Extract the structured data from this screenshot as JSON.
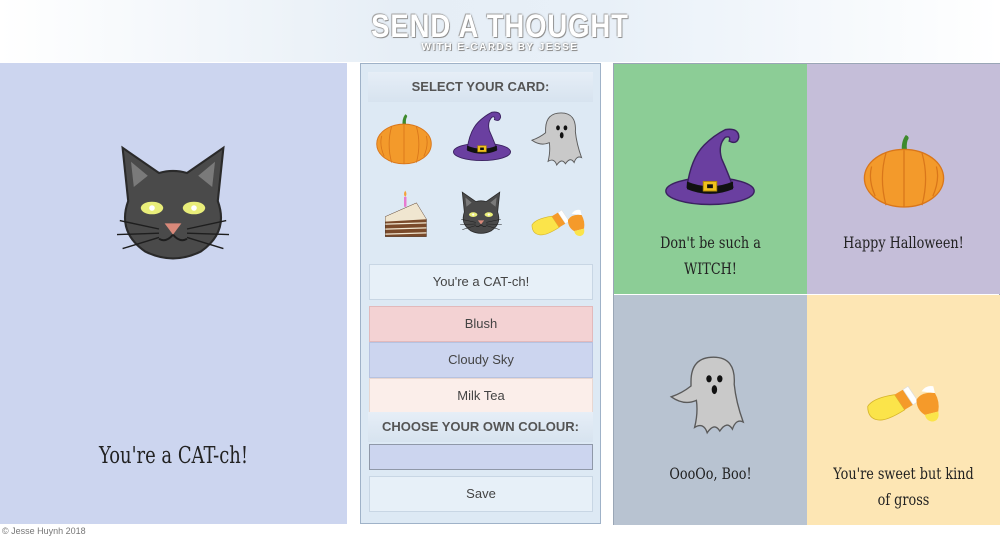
{
  "header": {
    "title": "SEND A THOUGHT",
    "subtitle": "WITH E-CARDS BY JESSE"
  },
  "preview": {
    "icon": "cat-icon",
    "message": "You're a CAT-ch!",
    "background": "#ccd5ef"
  },
  "controls": {
    "select_title": "SELECT YOUR CARD:",
    "icons": [
      "pumpkin-icon",
      "witch-hat-icon",
      "ghost-icon",
      "cake-icon",
      "cat-icon",
      "candy-corn-icon"
    ],
    "message_value": "You're a CAT-ch!",
    "colour_options": [
      {
        "label": "Blush",
        "color": "#f3d2d3"
      },
      {
        "label": "Cloudy Sky",
        "color": "#ccd5ef"
      },
      {
        "label": "Milk Tea",
        "color": "#fbeeea"
      }
    ],
    "custom_title": "CHOOSE YOUR OWN COLOUR:",
    "custom_color": "#ccd5ef",
    "save_label": "Save"
  },
  "gallery": [
    {
      "text": "Don't be such a WITCH!",
      "icon": "witch-hat-icon",
      "color": "#8ccd96"
    },
    {
      "text": "Happy Halloween!",
      "icon": "pumpkin-icon",
      "color": "#c5bed9"
    },
    {
      "text": "OooOo, Boo!",
      "icon": "ghost-icon",
      "color": "#b8c3d1"
    },
    {
      "text": "You're sweet but kind of gross",
      "icon": "candy-corn-icon",
      "color": "#fde6b4"
    }
  ],
  "footer": {
    "text": "© Jesse Huynh 2018"
  }
}
